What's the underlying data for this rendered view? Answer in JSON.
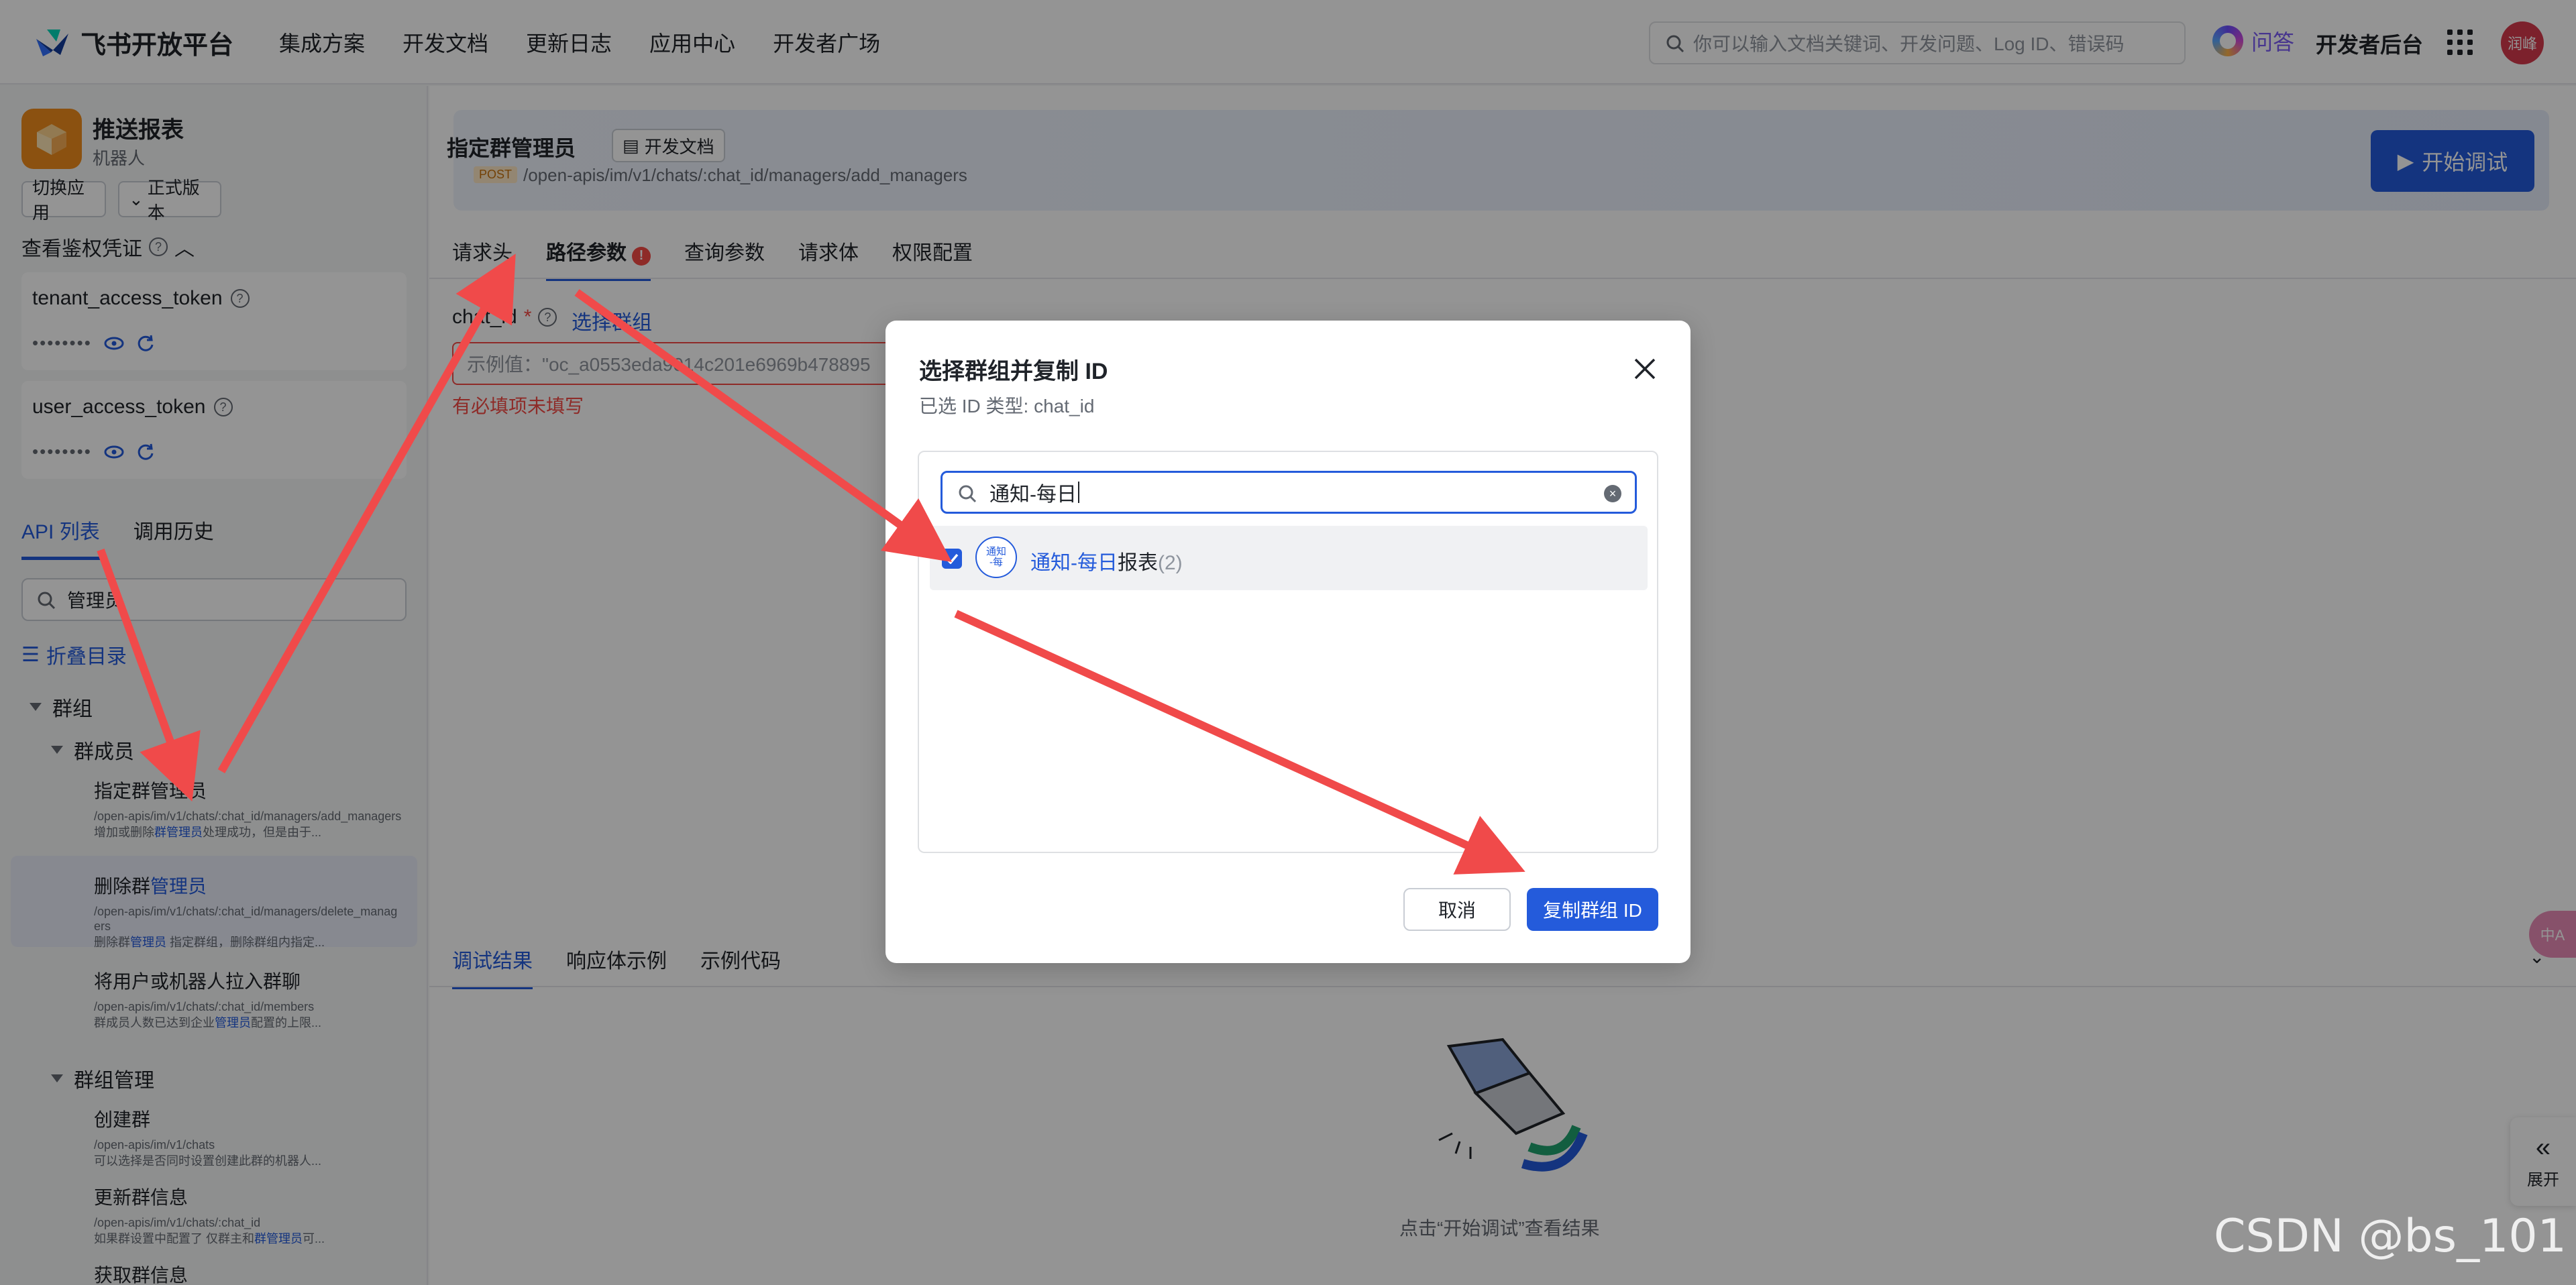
{
  "topnav": {
    "brand": "飞书开放平台",
    "links": [
      "集成方案",
      "开发文档",
      "更新日志",
      "应用中心",
      "开发者广场"
    ],
    "search_placeholder": "你可以输入文档关键词、开发问题、Log ID、错误码",
    "wenda": "问答",
    "dev_console": "开发者后台",
    "avatar_text": "润峰"
  },
  "sidebar": {
    "app_name": "推送报表",
    "app_type": "机器人",
    "switch_app": "切换应用",
    "version": "正式版本",
    "auth_label": "查看鉴权凭证",
    "tokens": [
      {
        "name": "tenant_access_token",
        "value": "••••••••"
      },
      {
        "name": "user_access_token",
        "value": "••••••••"
      }
    ],
    "tabs": [
      "API 列表",
      "调用历史"
    ],
    "search_value": "管理员",
    "fold_label": "折叠目录",
    "tree": {
      "group": "群组",
      "members": "群成员",
      "group_mgmt": "群组管理"
    },
    "apis": [
      {
        "title": "指定群管理员",
        "path": "/open-apis/im/v1/chats/:chat_id/managers/add_managers",
        "desc_a": "增加或删除",
        "desc_hl": "群管理员",
        "desc_b": "处理成功，但是由于..."
      },
      {
        "title_a": "删除群",
        "title_hl": "管理员",
        "path": "/open-apis/im/v1/chats/:chat_id/managers/delete_managers",
        "desc_a": "删除群",
        "desc_hl": "管理员",
        "desc_b": " 指定群组，删除群组内指定..."
      },
      {
        "title": "将用户或机器人拉入群聊",
        "path": "/open-apis/im/v1/chats/:chat_id/members",
        "desc_a": "群成员人数已达到企业",
        "desc_hl": "管理员",
        "desc_b": "配置的上限..."
      },
      {
        "title": "创建群",
        "path": "/open-apis/im/v1/chats",
        "desc_a": "可以选择是否同时设置创建此群的机器人...",
        "desc_hl": "",
        "desc_b": ""
      },
      {
        "title": "更新群信息",
        "path": "/open-apis/im/v1/chats/:chat_id",
        "desc_a": "如果群设置中配置了 仅群主和",
        "desc_hl": "群管理员",
        "desc_b": "可..."
      },
      {
        "title": "获取群信息",
        "path": "",
        "desc_a": "",
        "desc_hl": "",
        "desc_b": ""
      }
    ]
  },
  "main": {
    "api_title": "指定群管理员",
    "doc_button": "开发文档",
    "method": "POST",
    "path": "/open-apis/im/v1/chats/:chat_id/managers/add_managers",
    "start_button": "开始调试",
    "param_tabs": [
      "请求头",
      "路径参数",
      "查询参数",
      "请求体",
      "权限配置"
    ],
    "chat_id_label": "chat_id",
    "select_group": "选择群组",
    "input_placeholder": "示例值：\"oc_a0553eda9014c201e6969b478895",
    "required_error": "有必填项未填写",
    "result_tabs": [
      "调试结果",
      "响应体示例",
      "示例代码"
    ],
    "empty_hint": "点击“开始调试”查看结果",
    "expand": "展开"
  },
  "modal": {
    "title": "选择群组并复制 ID",
    "subtitle": "已选 ID 类型: chat_id",
    "search_value": "通知-每日",
    "group_avatar": "通知\n-每",
    "group_name_hl": "通知-每日",
    "group_name_rest": "报表",
    "group_count": "(2)",
    "cancel": "取消",
    "copy": "复制群组 ID"
  },
  "watermark": "CSDN @bs_101",
  "colors": {
    "primary": "#245bdb",
    "error": "#f54a45",
    "arrow": "#f04a4a"
  }
}
